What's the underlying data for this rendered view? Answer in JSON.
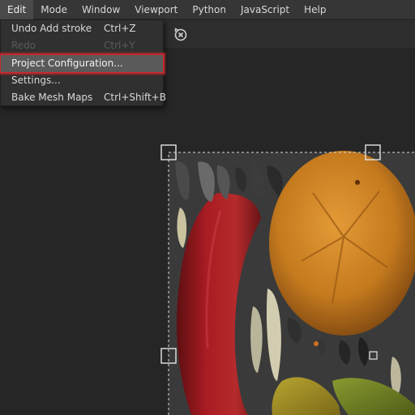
{
  "menubar": {
    "items": [
      {
        "label": "Edit"
      },
      {
        "label": "Mode"
      },
      {
        "label": "Window"
      },
      {
        "label": "Viewport"
      },
      {
        "label": "Python"
      },
      {
        "label": "JavaScript"
      },
      {
        "label": "Help"
      }
    ],
    "active_index": 0
  },
  "edit_menu": {
    "items": [
      {
        "label": "Undo Add stroke",
        "shortcut": "Ctrl+Z",
        "enabled": true
      },
      {
        "label": "Redo",
        "shortcut": "Ctrl+Y",
        "enabled": false
      },
      {
        "label": "Project Configuration...",
        "shortcut": "",
        "enabled": true,
        "highlighted": true
      },
      {
        "label": "Settings...",
        "shortcut": "",
        "enabled": true
      },
      {
        "label": "Bake Mesh Maps",
        "shortcut": "Ctrl+Shift+B",
        "enabled": true
      }
    ]
  },
  "toolbar": {
    "icon": "clear-selection-icon"
  },
  "colors": {
    "highlight_outline": "#c4282f",
    "menubar_bg": "#363636",
    "viewport_bg": "#262626",
    "uv_bg": "#3a3a3a"
  }
}
